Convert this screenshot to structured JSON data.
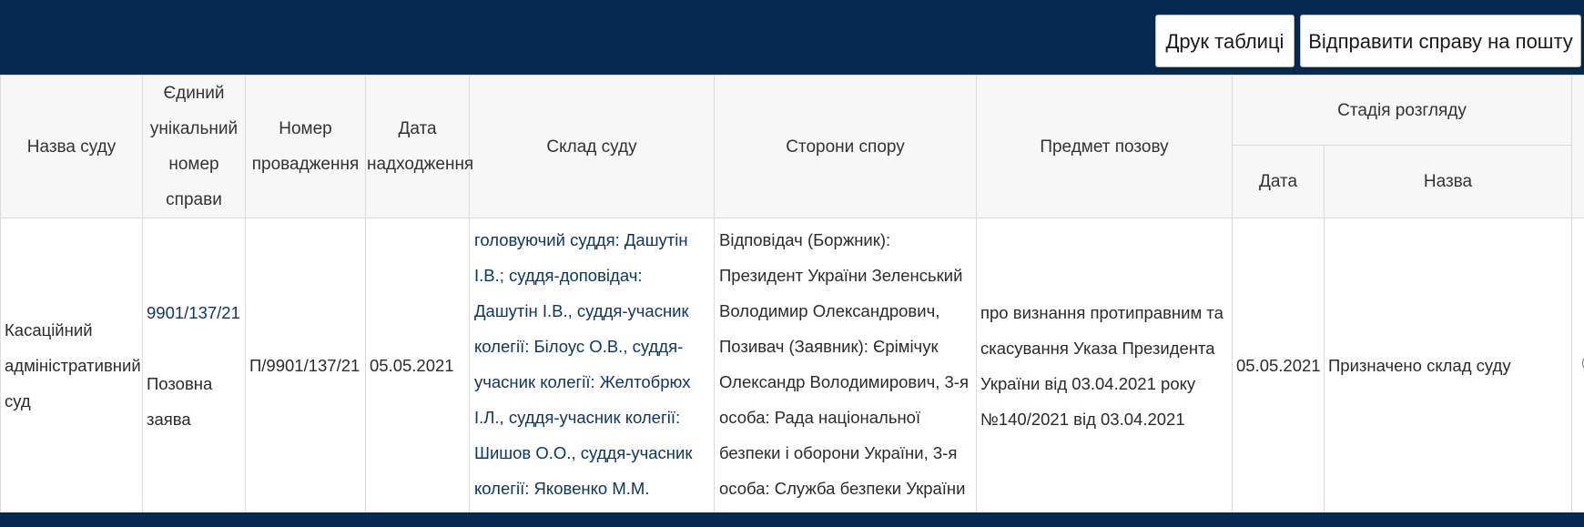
{
  "toolbar": {
    "print_label": "Друк таблиці",
    "mail_label": "Відправити справу на пошту"
  },
  "table": {
    "headers": {
      "court": "Назва суду",
      "case_number": "Єдиний унікальний номер справи",
      "proceeding_number": "Номер провадження",
      "received_date": "Дата надходження",
      "judges": "Склад суду",
      "parties": "Сторони спору",
      "subject": "Предмет позову",
      "stage": "Стадія розгляду",
      "stage_date": "Дата",
      "stage_name": "Назва"
    },
    "rows": [
      {
        "court": "Касаційний адміністративний суд",
        "case_number": "9901/137/21",
        "case_type": "Позовна заява",
        "proceeding_number": "П/9901/137/21",
        "received_date": "05.05.2021",
        "judges": "головуючий суддя: Дашутін І.В.; суддя-доповідач: Дашутін І.В., суддя-учасник колегії: Білоус О.В., суддя-учасник колегії: Желтобрюх І.Л., суддя-учасник колегії: Шишов О.О., суддя-учасник колегії: Яковенко М.М.",
        "parties": "Відповідач (Боржник): Президент України Зеленський Володимир Олександрович, Позивач (Заявник): Єрімічук Олександр Володимирович, 3-я особа: Рада національної безпеки і оборони України, 3-я особа: Служба безпеки України",
        "subject": "про визнання протиправним та скасування Указа Президента України від 03.04.2021 року №140/2021 від 03.04.2021",
        "stage_date": "05.05.2021",
        "stage_name": "Призначено склад суду"
      }
    ]
  }
}
